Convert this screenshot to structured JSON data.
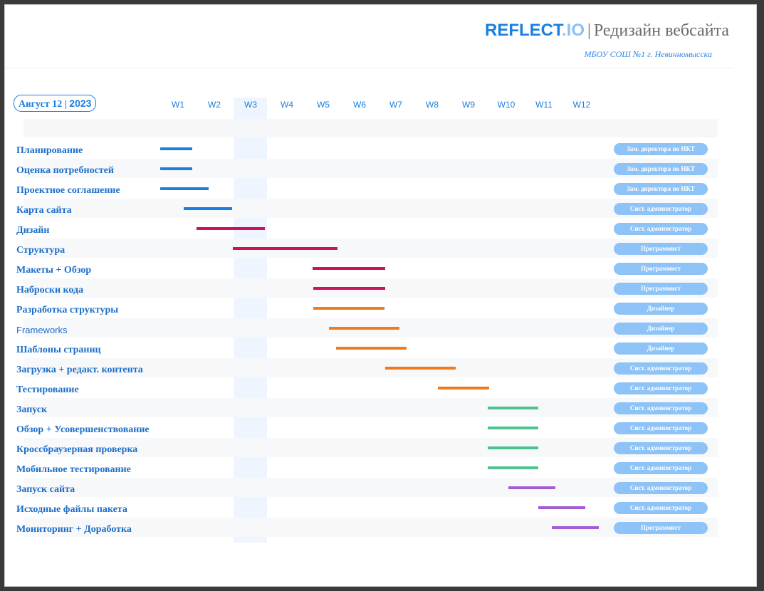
{
  "header": {
    "brand_part1": "REFLECT",
    "brand_part2": ".IO",
    "separator": "|",
    "title": "Редизайн вебсайта",
    "subtitle": "МБОУ СОШ №1 г. Невинномысска"
  },
  "date_label_text": "Август 12 | ",
  "date_label_year": "2023",
  "colors": {
    "planning": "#1a7fe0",
    "design": "#cc1357",
    "development": "#f07a1c",
    "launch": "#4cc38f",
    "maintenance": "#a65bd6",
    "owner_pill": "#8ec3f7",
    "highlight_week": "#eef5fe"
  },
  "chart_data": {
    "type": "gantt",
    "title": "Редизайн вебсайта",
    "weeks": [
      "W1",
      "W2",
      "W3",
      "W4",
      "W5",
      "W6",
      "W7",
      "W8",
      "W9",
      "W10",
      "W11",
      "W12"
    ],
    "highlighted_week": "W3",
    "tasks": [
      {
        "name": "Планирование",
        "start": 0.5,
        "end": 1.4,
        "phase": "planning",
        "owner": "Зам. директора по НКТ"
      },
      {
        "name": "Оценка потребностей",
        "start": 0.5,
        "end": 1.4,
        "phase": "planning",
        "owner": "Зам. директора по НКТ"
      },
      {
        "name": "Проектное соглашение",
        "start": 0.5,
        "end": 1.85,
        "phase": "planning",
        "owner": "Зам. директора по НКТ"
      },
      {
        "name": "Карта сайта",
        "start": 1.15,
        "end": 2.5,
        "phase": "planning",
        "owner": "Сист. администратор"
      },
      {
        "name": "Дизайн",
        "start": 1.5,
        "end": 3.4,
        "phase": "design",
        "owner": "Сист. администратор"
      },
      {
        "name": "Структура",
        "start": 2.5,
        "end": 5.4,
        "phase": "design",
        "owner": "Программист"
      },
      {
        "name": "Макеты + Обзор",
        "start": 4.7,
        "end": 6.7,
        "phase": "design",
        "owner": "Программист"
      },
      {
        "name": "Наброски кода",
        "start": 4.72,
        "end": 6.7,
        "phase": "design",
        "owner": "Программист"
      },
      {
        "name": "Разработка структуры",
        "start": 4.72,
        "end": 6.68,
        "phase": "development",
        "owner": "Дизайнер"
      },
      {
        "name": "Frameworks",
        "start": 5.15,
        "end": 7.1,
        "phase": "development",
        "owner": "Дизайнер"
      },
      {
        "name": "Шаблоны страниц",
        "start": 5.35,
        "end": 7.3,
        "phase": "development",
        "owner": "Дизайнер"
      },
      {
        "name": "Загрузка + редакт. контента",
        "start": 6.7,
        "end": 8.65,
        "phase": "development",
        "owner": "Сист. администратор"
      },
      {
        "name": "Тестирование",
        "start": 8.15,
        "end": 9.55,
        "phase": "development",
        "owner": "Сист. администратор"
      },
      {
        "name": "Запуск",
        "start": 9.5,
        "end": 10.85,
        "phase": "launch",
        "owner": "Сист. администратор"
      },
      {
        "name": "Обзор + Усовершенствование",
        "start": 9.5,
        "end": 10.85,
        "phase": "launch",
        "owner": "Сист. администратор"
      },
      {
        "name": "Кроссбраузерная проверка",
        "start": 9.5,
        "end": 10.85,
        "phase": "launch",
        "owner": "Сист. администратор"
      },
      {
        "name": "Мобильное тестирование",
        "start": 9.5,
        "end": 10.85,
        "phase": "launch",
        "owner": "Сист. администратор"
      },
      {
        "name": "Запуск сайта",
        "start": 10.05,
        "end": 11.3,
        "phase": "maintenance",
        "owner": "Сист. администратор"
      },
      {
        "name": "Исходные файлы пакета",
        "start": 10.85,
        "end": 12.1,
        "phase": "maintenance",
        "owner": "Сист. администратор"
      },
      {
        "name": "Мониторинг + Доработка",
        "start": 11.2,
        "end": 12.45,
        "phase": "maintenance",
        "owner": "Программист"
      }
    ]
  }
}
